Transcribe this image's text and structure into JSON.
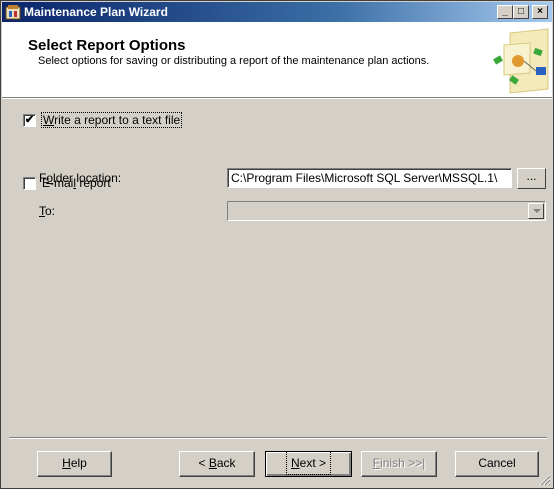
{
  "window": {
    "title": "Maintenance Plan Wizard",
    "controls": [
      "_",
      "□",
      "×"
    ]
  },
  "header": {
    "title": "Select Report Options",
    "subtitle": "Select options for saving or distributing a report of the maintenance plan actions."
  },
  "options": {
    "write_report": {
      "checked": true,
      "mark": "✔",
      "label_pre": "",
      "label_ul": "W",
      "label_post": "rite a report to a text file"
    },
    "folder_location": {
      "label_pre": "F",
      "label_ul": "o",
      "label_post": "lder location:",
      "value": "C:\\Program Files\\Microsoft SQL Server\\MSSQL.1\\"
    },
    "browse_button": "...",
    "email_report": {
      "checked": false,
      "mark": "",
      "label_pre": "E-mai",
      "label_ul": "l",
      "label_post": " report"
    },
    "to": {
      "label_pre": "",
      "label_ul": "T",
      "label_post": "o:",
      "value": ""
    }
  },
  "buttons": {
    "help": {
      "pre": "",
      "ul": "H",
      "post": "elp"
    },
    "back": {
      "pre": "< ",
      "ul": "B",
      "post": "ack"
    },
    "next": {
      "pre": "",
      "ul": "N",
      "post": "ext >"
    },
    "finish": {
      "pre": "",
      "ul": "F",
      "post": "inish >>|"
    },
    "cancel": {
      "pre": "Cancel",
      "ul": "",
      "post": ""
    }
  },
  "icons": {
    "app": "wizard-app-icon",
    "header_art": "maintenance-plan-art"
  },
  "colors": {
    "title_start": "#0a246a",
    "title_end": "#a6caf0",
    "face": "#d4d0c8"
  }
}
